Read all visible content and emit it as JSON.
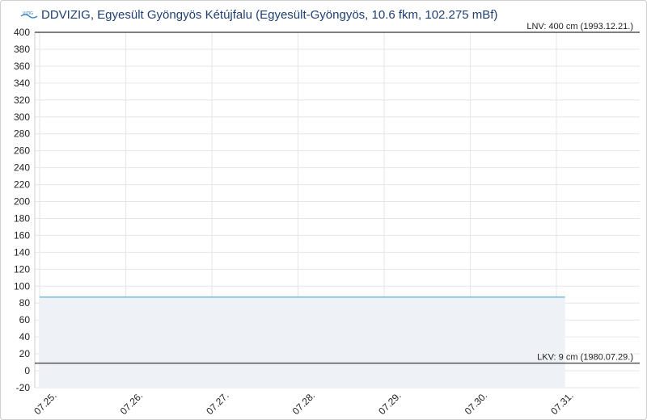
{
  "header": {
    "title": "DDVIZIG, Egyesült Gyöngyös Kétújfalu (Egyesült-Gyöngyös, 10.6 fkm, 102.275 mBf)",
    "logo_text": "VIZIG"
  },
  "colors": {
    "title": "#1f3f73",
    "series_line": "#5bb3d6",
    "area_fill": "#eef1f6",
    "ref_line": "#555555",
    "grid": "#e6e6e6"
  },
  "chart_data": {
    "type": "area",
    "title": "",
    "xlabel": "",
    "ylabel": "",
    "ylim": [
      -20,
      400
    ],
    "y_ticks": [
      -20,
      0,
      20,
      40,
      60,
      80,
      100,
      120,
      140,
      160,
      180,
      200,
      220,
      240,
      260,
      280,
      300,
      320,
      340,
      360,
      380,
      400
    ],
    "x_tick_labels": [
      "07.25.",
      "07.26.",
      "07.27.",
      "07.28.",
      "07.29.",
      "07.30.",
      "07.31."
    ],
    "xlim_days": [
      0,
      7
    ],
    "grid": true,
    "series": [
      {
        "values": [
          [
            0,
            87
          ],
          [
            6.1,
            87
          ]
        ],
        "x_unit": "days from 07.25."
      }
    ],
    "reference_lines": [
      {
        "value": 400,
        "label": "LNV: 400 cm (1993.12.21.)"
      },
      {
        "value": 9,
        "label": "LKV: 9 cm (1980.07.29.)"
      }
    ]
  }
}
